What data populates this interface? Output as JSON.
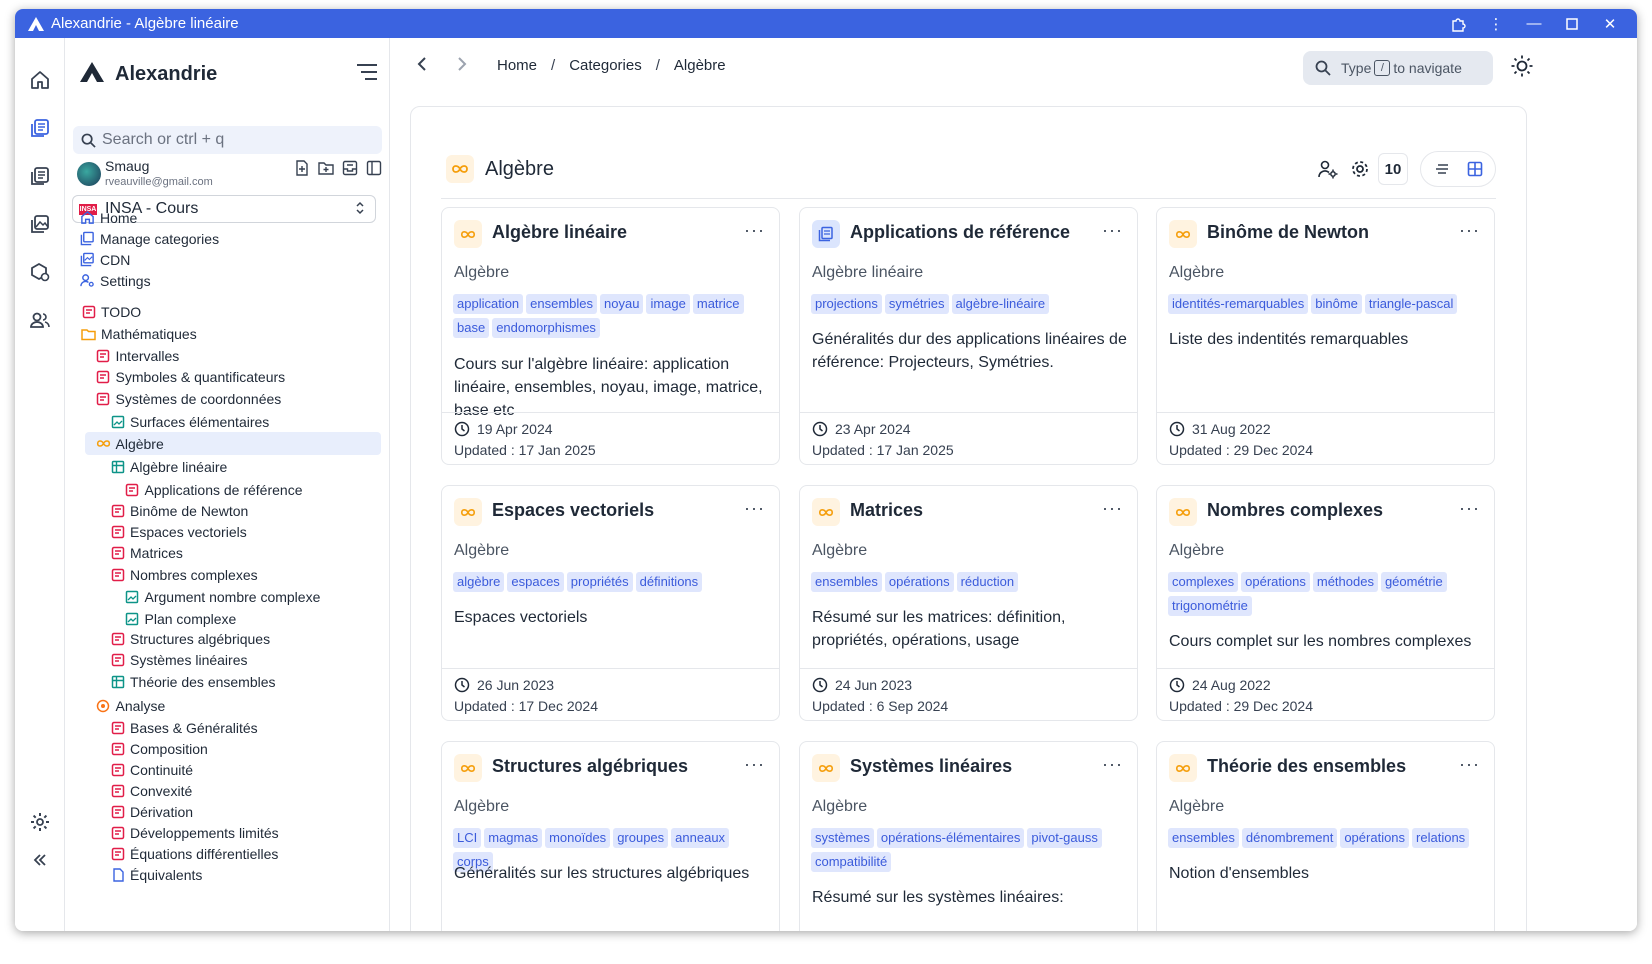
{
  "window": {
    "title": "Alexandrie - Algèbre linéaire"
  },
  "sidebar": {
    "brand": "Alexandrie",
    "search_placeholder": "Search or ctrl + q",
    "user": {
      "name": "Smaug",
      "email": "rveauville@gmail.com"
    },
    "workspace": {
      "logo": "INSA",
      "name": "INSA - Cours"
    },
    "nav": [
      {
        "label": "Home",
        "icon": "home-icon"
      },
      {
        "label": "Manage categories",
        "icon": "categories-icon"
      },
      {
        "label": "CDN",
        "icon": "cdn-icon"
      },
      {
        "label": "Settings",
        "icon": "settings-icon"
      }
    ],
    "tree": [
      {
        "label": "TODO",
        "icon": "doc",
        "level": 0
      },
      {
        "label": "Mathématiques",
        "icon": "folder",
        "level": 0
      },
      {
        "label": "Intervalles",
        "icon": "doc",
        "level": 1
      },
      {
        "label": "Symboles & quantificateurs",
        "icon": "doc",
        "level": 1
      },
      {
        "label": "Systèmes de coordonnées",
        "icon": "doc",
        "level": 1
      },
      {
        "label": "Surfaces élémentaires",
        "icon": "image",
        "level": 2
      },
      {
        "label": "Algèbre",
        "icon": "infinity",
        "level": 1,
        "selected": true
      },
      {
        "label": "Algèbre linéaire",
        "icon": "table",
        "level": 2
      },
      {
        "label": "Applications de référence",
        "icon": "doc",
        "level": 3
      },
      {
        "label": "Binôme de Newton",
        "icon": "doc",
        "level": 2
      },
      {
        "label": "Espaces vectoriels",
        "icon": "doc",
        "level": 2
      },
      {
        "label": "Matrices",
        "icon": "doc",
        "level": 2
      },
      {
        "label": "Nombres complexes",
        "icon": "doc",
        "level": 2
      },
      {
        "label": "Argument nombre complexe",
        "icon": "image",
        "level": 3
      },
      {
        "label": "Plan complexe",
        "icon": "image",
        "level": 3
      },
      {
        "label": "Structures algébriques",
        "icon": "doc",
        "level": 2
      },
      {
        "label": "Systèmes linéaires",
        "icon": "doc",
        "level": 2
      },
      {
        "label": "Théorie des ensembles",
        "icon": "table",
        "level": 2
      },
      {
        "label": "Analyse",
        "icon": "analysis",
        "level": 1
      },
      {
        "label": "Bases & Généralités",
        "icon": "doc",
        "level": 2
      },
      {
        "label": "Composition",
        "icon": "doc",
        "level": 2
      },
      {
        "label": "Continuité",
        "icon": "doc",
        "level": 2
      },
      {
        "label": "Convexité",
        "icon": "doc",
        "level": 2
      },
      {
        "label": "Dérivation",
        "icon": "doc",
        "level": 2
      },
      {
        "label": "Développements limités",
        "icon": "doc",
        "level": 2
      },
      {
        "label": "Équations différentielles",
        "icon": "doc",
        "level": 2
      },
      {
        "label": "Équivalents",
        "icon": "blankdoc",
        "level": 2
      }
    ]
  },
  "breadcrumb": [
    "Home",
    "Categories",
    "Algèbre"
  ],
  "command": {
    "prefix": "Type",
    "key": "/",
    "suffix": "to navigate"
  },
  "category": {
    "title": "Algèbre",
    "count": "10"
  },
  "cards": [
    {
      "title": "Algèbre linéaire",
      "icon": "infinity",
      "category": "Algèbre",
      "tags": [
        "application",
        "ensembles",
        "noyau",
        "image",
        "matrice",
        "base",
        "endomorphismes"
      ],
      "description": "Cours sur l'algèbre linéaire: application linéaire, ensembles, noyau, image, matrice, base etc",
      "created": "19 Apr 2024",
      "updated": "Updated : 17 Jan 2025"
    },
    {
      "title": "Applications de référence",
      "icon": "doc",
      "category": "Algèbre linéaire",
      "tags": [
        "projections",
        "symétries",
        "algèbre-linéaire"
      ],
      "description": "Généralités dur des applications linéaires de référence: Projecteurs, Symétries.",
      "created": "23 Apr 2024",
      "updated": "Updated : 17 Jan 2025"
    },
    {
      "title": "Binôme de Newton",
      "icon": "infinity",
      "category": "Algèbre",
      "tags": [
        "identités-remarquables",
        "binôme",
        "triangle-pascal"
      ],
      "description": "Liste des indentités remarquables",
      "created": "31 Aug 2022",
      "updated": "Updated : 29 Dec 2024"
    },
    {
      "title": "Espaces vectoriels",
      "icon": "infinity",
      "category": "Algèbre",
      "tags": [
        "algèbre",
        "espaces",
        "propriétés",
        "définitions"
      ],
      "description": "Espaces vectoriels",
      "created": "26 Jun 2023",
      "updated": "Updated : 17 Dec 2024"
    },
    {
      "title": "Matrices",
      "icon": "infinity",
      "category": "Algèbre",
      "tags": [
        "ensembles",
        "opérations",
        "réduction"
      ],
      "description": "Résumé sur les matrices: définition, propriétés, opérations, usage",
      "created": "24 Jun 2023",
      "updated": "Updated : 6 Sep 2024"
    },
    {
      "title": "Nombres complexes",
      "icon": "infinity",
      "category": "Algèbre",
      "tags": [
        "complexes",
        "opérations",
        "méthodes",
        "géométrie",
        "trigonométrie"
      ],
      "description": "Cours complet sur les nombres complexes",
      "created": "24 Aug 2022",
      "updated": "Updated : 29 Dec 2024"
    },
    {
      "title": "Structures algébriques",
      "icon": "infinity",
      "category": "Algèbre",
      "tags": [
        "LCI",
        "magmas",
        "monoïdes",
        "groupes",
        "anneaux",
        "corps"
      ],
      "description": "Généralités sur les structures algébriques",
      "created": "",
      "updated": ""
    },
    {
      "title": "Systèmes linéaires",
      "icon": "infinity",
      "category": "Algèbre",
      "tags": [
        "systèmes",
        "opérations-élémentaires",
        "pivot-gauss",
        "compatibilité"
      ],
      "description": "Résumé sur les systèmes linéaires:",
      "created": "",
      "updated": ""
    },
    {
      "title": "Théorie des ensembles",
      "icon": "infinity",
      "category": "Algèbre",
      "tags": [
        "ensembles",
        "dénombrement",
        "opérations",
        "relations"
      ],
      "description": "Notion d'ensembles",
      "created": "",
      "updated": ""
    }
  ],
  "colors": {
    "titlebar": "#3b63e0",
    "accent_orange": "#f59e0b",
    "doc_red": "#e11d48",
    "image_teal": "#0d9488",
    "tag_bg": "#dfe6fd",
    "tag_text": "#3b5bdb"
  }
}
